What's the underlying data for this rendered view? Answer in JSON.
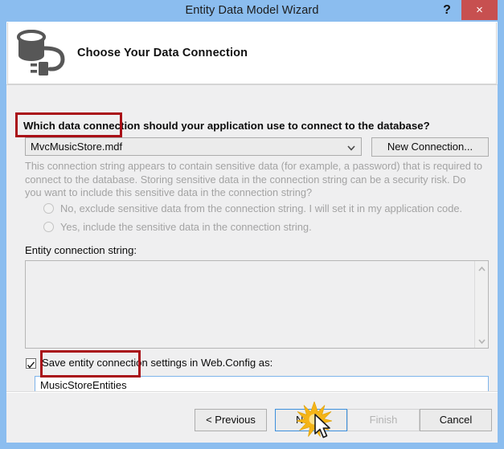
{
  "window": {
    "title": "Entity Data Model Wizard",
    "help_label": "?",
    "close_label": "×",
    "titlebar_color": "#8bbdef",
    "close_color": "#c75050"
  },
  "header": {
    "icon": "database-connection-icon",
    "title": "Choose Your Data Connection"
  },
  "main": {
    "question_label": "Which data connection should your application use to connect to the database?",
    "connection_combo": {
      "value": "MvcMusicStore.mdf",
      "arrow_icon": "chevron-down-icon"
    },
    "new_connection_label": "New Connection...",
    "sensitive_note": "This connection string appears to contain sensitive data (for example, a password) that is required to connect to the database. Storing sensitive data in the connection string can be a security risk. Do you want to include this sensitive data in the connection string?",
    "radios": [
      {
        "label": "No, exclude sensitive data from the connection string. I will set it in my application code.",
        "selected": false,
        "disabled": true
      },
      {
        "label": "Yes, include the sensitive data in the connection string.",
        "selected": false,
        "disabled": true
      }
    ],
    "entity_connection_string_label": "Entity connection string:",
    "entity_connection_string_value": "",
    "scrollbar": {
      "up_icon": "chevron-up-icon",
      "down_icon": "chevron-down-icon"
    },
    "save_checkbox": {
      "label": "Save entity connection settings in Web.Config as:",
      "checked": true
    },
    "entity_name_value": "MusicStoreEntities"
  },
  "footer": {
    "previous_label": "< Previous",
    "next_label": "Next >",
    "finish_label": "Finish",
    "cancel_label": "Cancel"
  },
  "annotations": {
    "highlight_color": "#a91017",
    "starburst_color": "#f5b417",
    "cursor_icon": "mouse-pointer-icon",
    "click_target": "Next >"
  }
}
